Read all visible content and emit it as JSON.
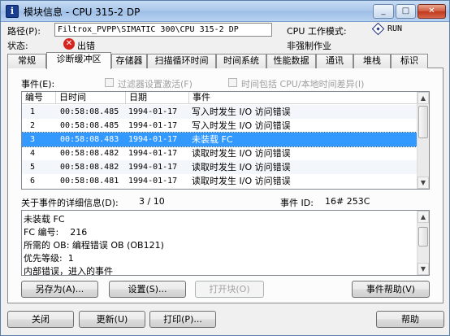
{
  "window": {
    "title": "模块信息 - CPU 315-2 DP",
    "controls": [
      "_",
      "□",
      "✕"
    ]
  },
  "header": {
    "path_label": "路径(P):",
    "path_value": "Filtrox_PVPP\\SIMATIC 300\\CPU 315-2 DP",
    "cpu_mode_label": "CPU 工作模式:",
    "cpu_mode_value": "RUN",
    "status_label": "状态:",
    "status_value": "出错",
    "force_value": "非强制作业"
  },
  "tabs": [
    "常规",
    "诊断缓冲区",
    "存储器",
    "扫描循环时间",
    "时间系统",
    "性能数据",
    "通讯",
    "堆栈",
    "标识"
  ],
  "active_tab": "诊断缓冲区",
  "events_label": "事件(E):",
  "filter_label": "过滤器设置激活(F)",
  "time_option_label": "时间包括 CPU/本地时间差异(I)",
  "events": {
    "columns": [
      "编号",
      "日时间",
      "日期",
      "事件"
    ],
    "rows": [
      {
        "no": "1",
        "time": "00:58:08.485",
        "date": "1994-01-17",
        "event": "写入时发生 I/O 访问错误"
      },
      {
        "no": "2",
        "time": "00:58:08.485",
        "date": "1994-01-17",
        "event": "写入时发生 I/O 访问错误"
      },
      {
        "no": "3",
        "time": "00:58:08.483",
        "date": "1994-01-17",
        "event": "未装载 FC"
      },
      {
        "no": "4",
        "time": "00:58:08.482",
        "date": "1994-01-17",
        "event": "读取时发生 I/O 访问错误"
      },
      {
        "no": "5",
        "time": "00:58:08.482",
        "date": "1994-01-17",
        "event": "读取时发生 I/O 访问错误"
      },
      {
        "no": "6",
        "time": "00:58:08.481",
        "date": "1994-01-17",
        "event": "读取时发生 I/O 访问错误"
      }
    ],
    "selected_index": 2
  },
  "details": {
    "label": "关于事件的详细信息(D):",
    "position": "3 / 10",
    "event_id_label": "事件 ID:",
    "event_id_value": "16# 253C",
    "lines": [
      "未装载 FC",
      "FC 编号:    216",
      "所需的 OB: 编程错误 OB (OB121)",
      "优先等级:  1",
      "内部错误，进入的事件"
    ]
  },
  "panel_buttons": {
    "save_as": "另存为(A)...",
    "settings": "设置(S)...",
    "open_block": "打开块(O)",
    "event_help": "事件帮助(V)"
  },
  "bottom_buttons": {
    "close": "关闭",
    "update": "更新(U)",
    "print": "打印(P)...",
    "help": "帮助"
  }
}
